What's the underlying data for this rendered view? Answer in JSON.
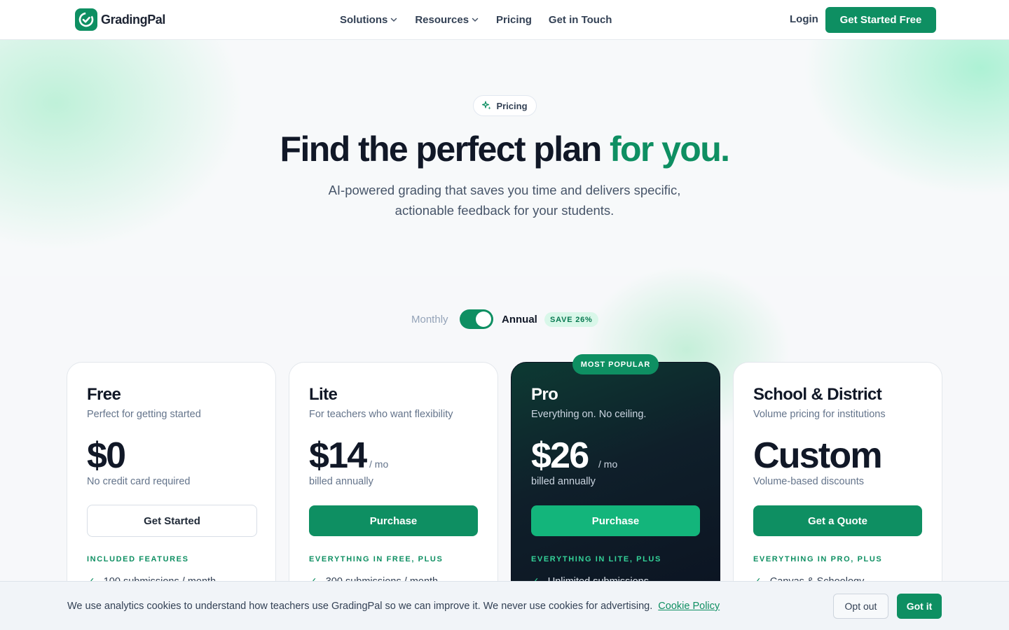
{
  "nav": {
    "logo_text": "GradingPal",
    "links": [
      {
        "label": "Solutions",
        "has_dropdown": true
      },
      {
        "label": "Resources",
        "has_dropdown": true
      },
      {
        "label": "Pricing",
        "has_dropdown": false
      },
      {
        "label": "Get in Touch",
        "has_dropdown": false
      }
    ],
    "login_label": "Login",
    "cta_label": "Get Started Free"
  },
  "hero": {
    "pill_label": "Pricing",
    "pill_icon": "sparkle-icon",
    "title_main": "Find the perfect plan",
    "title_accent": "for you.",
    "subtitle_line1": "AI-powered grading that saves you time and delivers specific,",
    "subtitle_line2": "actionable feedback for your students."
  },
  "billing": {
    "monthly_label": "Monthly",
    "annual_label": "Annual",
    "selected": "Annual",
    "save_badge": "SAVE 26%"
  },
  "plans": [
    {
      "name": "Free",
      "tagline": "Perfect for getting started",
      "price": "$0",
      "unit": "",
      "note": "No credit card required",
      "button": "Get Started",
      "section": "INCLUDED FEATURES",
      "first_feature": "100 submissions / month"
    },
    {
      "name": "Lite",
      "tagline": "For teachers who want flexibility",
      "price": "$14",
      "unit": "/ mo",
      "note": "billed annually",
      "button": "Purchase",
      "section": "EVERYTHING IN FREE, PLUS",
      "first_feature": "300 submissions / month"
    },
    {
      "name": "Pro",
      "badge": "MOST POPULAR",
      "tagline": "Everything on. No ceiling.",
      "price": "$26",
      "unit": "/ mo",
      "note": "billed annually",
      "button": "Purchase",
      "section": "EVERYTHING IN LITE, PLUS",
      "first_feature": "Unlimited submissions"
    },
    {
      "name": "School & District",
      "tagline": "Volume pricing for institutions",
      "price": "Custom",
      "unit": "",
      "note": "Volume-based discounts",
      "button": "Get a Quote",
      "section": "EVERYTHING IN PRO, PLUS",
      "first_feature": "Canvas & Schoology"
    }
  ],
  "cookie": {
    "text": "We use analytics cookies to understand how teachers use GradingPal so we can improve it. We never use cookies for advertising.",
    "link": "Cookie Policy",
    "opt_out": "Opt out",
    "accept": "Got it"
  },
  "colors": {
    "brand": "#0e8f62",
    "brand_light": "#13b57b",
    "dark_card": "#0b1120"
  }
}
